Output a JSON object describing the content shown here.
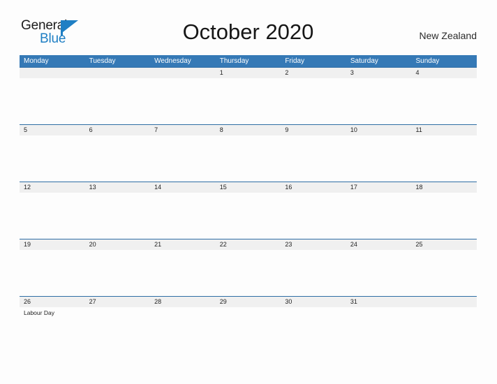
{
  "logo": {
    "word_one": "General",
    "word_two": "Blue",
    "flag_icon": "blue-triangle-flag-icon",
    "color_text": "#1c1c1c",
    "color_blue": "#1f7fc4"
  },
  "header": {
    "title": "October 2020",
    "country": "New Zealand"
  },
  "theme": {
    "header_blue": "#3579b6",
    "row_divider_blue": "#2e6da4",
    "date_band": "#f0f0f0",
    "page_background": "#fdfdfd"
  },
  "calendar": {
    "weekday_headers": [
      "Monday",
      "Tuesday",
      "Wednesday",
      "Thursday",
      "Friday",
      "Saturday",
      "Sunday"
    ],
    "weeks": [
      {
        "days": [
          {
            "date": "",
            "event": ""
          },
          {
            "date": "",
            "event": ""
          },
          {
            "date": "",
            "event": ""
          },
          {
            "date": "1",
            "event": ""
          },
          {
            "date": "2",
            "event": ""
          },
          {
            "date": "3",
            "event": ""
          },
          {
            "date": "4",
            "event": ""
          }
        ]
      },
      {
        "days": [
          {
            "date": "5",
            "event": ""
          },
          {
            "date": "6",
            "event": ""
          },
          {
            "date": "7",
            "event": ""
          },
          {
            "date": "8",
            "event": ""
          },
          {
            "date": "9",
            "event": ""
          },
          {
            "date": "10",
            "event": ""
          },
          {
            "date": "11",
            "event": ""
          }
        ]
      },
      {
        "days": [
          {
            "date": "12",
            "event": ""
          },
          {
            "date": "13",
            "event": ""
          },
          {
            "date": "14",
            "event": ""
          },
          {
            "date": "15",
            "event": ""
          },
          {
            "date": "16",
            "event": ""
          },
          {
            "date": "17",
            "event": ""
          },
          {
            "date": "18",
            "event": ""
          }
        ]
      },
      {
        "days": [
          {
            "date": "19",
            "event": ""
          },
          {
            "date": "20",
            "event": ""
          },
          {
            "date": "21",
            "event": ""
          },
          {
            "date": "22",
            "event": ""
          },
          {
            "date": "23",
            "event": ""
          },
          {
            "date": "24",
            "event": ""
          },
          {
            "date": "25",
            "event": ""
          }
        ]
      },
      {
        "days": [
          {
            "date": "26",
            "event": "Labour Day"
          },
          {
            "date": "27",
            "event": ""
          },
          {
            "date": "28",
            "event": ""
          },
          {
            "date": "29",
            "event": ""
          },
          {
            "date": "30",
            "event": ""
          },
          {
            "date": "31",
            "event": ""
          },
          {
            "date": "",
            "event": ""
          }
        ]
      }
    ]
  }
}
